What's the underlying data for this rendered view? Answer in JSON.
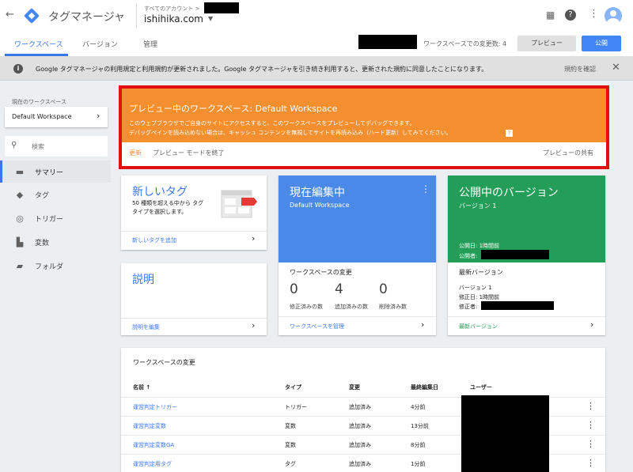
{
  "header": {
    "app_title": "タグマネージャ",
    "account_breadcrumb": "すべてのアカウント >",
    "container_name": "ishihika.com",
    "tabs": [
      {
        "label": "ワークスペース"
      },
      {
        "label": "バージョン"
      },
      {
        "label": "管理"
      }
    ],
    "workspace_changes": "ワークスペースでの変更数: 4",
    "preview_button": "プレビュー",
    "publish_button": "公開"
  },
  "notice": {
    "text": "Google タグマネージャの利用規定と利用規約が更新されました。Google タグマネージャを引き続き利用すると、更新された規約に同意したことになります。",
    "link": "規約を確認"
  },
  "sidebar": {
    "current_workspace_label": "現在のワークスペース",
    "workspace_name": "Default Workspace",
    "search_placeholder": "検索",
    "items": [
      {
        "label": "サマリー"
      },
      {
        "label": "タグ"
      },
      {
        "label": "トリガー"
      },
      {
        "label": "変数"
      },
      {
        "label": "フォルダ"
      }
    ]
  },
  "preview_banner": {
    "title": "プレビュー中のワークスペース: Default Workspace",
    "line1": "このウェブブラウザでご自身のサイトにアクセスすると、このワークスペースをプレビューしてデバッグできます。",
    "line2": "デバッグペインを読み込めない場合は、キャッシュ コンテンツを無視してサイトを再読み込み（ハード更新）してみてください。",
    "help": "?",
    "refresh": "更新",
    "exit": "プレビュー モードを終了",
    "share": "プレビューの共有"
  },
  "new_tag_card": {
    "title": "新しいタグ",
    "desc": "50 種類を超える中から タグタイプを選択します。",
    "link": "新しいタグを追加"
  },
  "description_card": {
    "title": "説明",
    "link": "説明を編集"
  },
  "current_edit_card": {
    "title": "現在編集中",
    "subtitle": "Default Workspace",
    "section": "ワークスペースの変更",
    "stats": [
      {
        "value": "0",
        "label": "修正済みの数"
      },
      {
        "value": "4",
        "label": "追加済みの数"
      },
      {
        "value": "0",
        "label": "削除済み数"
      }
    ],
    "link": "ワークスペースを管理"
  },
  "published_card": {
    "title": "公開中のバージョン",
    "subtitle": "バージョン 1",
    "published_at": "公開日: 1時間前",
    "published_by": "公開者:",
    "section": "最新バージョン",
    "version": "バージョン 1",
    "modified_at": "修正日: 1時間前",
    "modified_by": "修正者:",
    "link": "最新バージョン"
  },
  "changes_table": {
    "title": "ワークスペースの変更",
    "columns": [
      "名前 ↑",
      "タイプ",
      "変更",
      "最終編集日",
      "ユーザー"
    ],
    "rows": [
      {
        "name": "運営判定トリガー",
        "type": "トリガー",
        "change": "追加済み",
        "date": "4分前"
      },
      {
        "name": "運営判定変数",
        "type": "変数",
        "change": "追加済み",
        "date": "13分前"
      },
      {
        "name": "運営判定変数GA",
        "type": "変数",
        "change": "追加済み",
        "date": "8分前"
      },
      {
        "name": "運営判定用タグ",
        "type": "タグ",
        "change": "追加済み",
        "date": "1分前"
      }
    ]
  },
  "colors": {
    "accent": "#3b78e7",
    "preview_orange": "#f48f30",
    "published_green": "#239d58",
    "highlight_red": "#e01010"
  }
}
